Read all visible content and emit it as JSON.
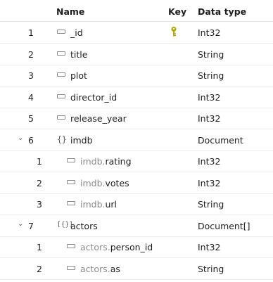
{
  "header": {
    "name": "Name",
    "key": "Key",
    "data_type": "Data type"
  },
  "rows": [
    {
      "num": "1",
      "prefix": "",
      "name": "_id",
      "type": "Int32",
      "key": true,
      "level": 0,
      "icon": "field"
    },
    {
      "num": "2",
      "prefix": "",
      "name": "title",
      "type": "String",
      "key": false,
      "level": 0,
      "icon": "field"
    },
    {
      "num": "3",
      "prefix": "",
      "name": "plot",
      "type": "String",
      "key": false,
      "level": 0,
      "icon": "field"
    },
    {
      "num": "4",
      "prefix": "",
      "name": "director_id",
      "type": "Int32",
      "key": false,
      "level": 0,
      "icon": "field"
    },
    {
      "num": "5",
      "prefix": "",
      "name": "release_year",
      "type": "Int32",
      "key": false,
      "level": 0,
      "icon": "field"
    },
    {
      "num": "6",
      "prefix": "",
      "name": "imdb",
      "type": "Document",
      "key": false,
      "level": 0,
      "icon": "document",
      "expanded": true
    },
    {
      "num": "1",
      "prefix": "imdb.",
      "name": "rating",
      "type": "Int32",
      "key": false,
      "level": 1,
      "icon": "field"
    },
    {
      "num": "2",
      "prefix": "imdb.",
      "name": "votes",
      "type": "Int32",
      "key": false,
      "level": 1,
      "icon": "field"
    },
    {
      "num": "3",
      "prefix": "imdb.",
      "name": "url",
      "type": "String",
      "key": false,
      "level": 1,
      "icon": "field"
    },
    {
      "num": "7",
      "prefix": "",
      "name": "actors",
      "type": "Document[]",
      "key": false,
      "level": 0,
      "icon": "document-array",
      "expanded": true
    },
    {
      "num": "1",
      "prefix": "actors.",
      "name": "person_id",
      "type": "Int32",
      "key": false,
      "level": 1,
      "icon": "field"
    },
    {
      "num": "2",
      "prefix": "actors.",
      "name": "as",
      "type": "String",
      "key": false,
      "level": 1,
      "icon": "field"
    }
  ],
  "icons": {
    "field": "field-icon",
    "document": "braces-icon",
    "document_array": "bracket-braces-icon",
    "key": "key-icon",
    "expand": "chevron-down-icon"
  },
  "colors": {
    "key": "#b8a800",
    "prefix": "#8c8c8c",
    "border": "#ececec"
  }
}
